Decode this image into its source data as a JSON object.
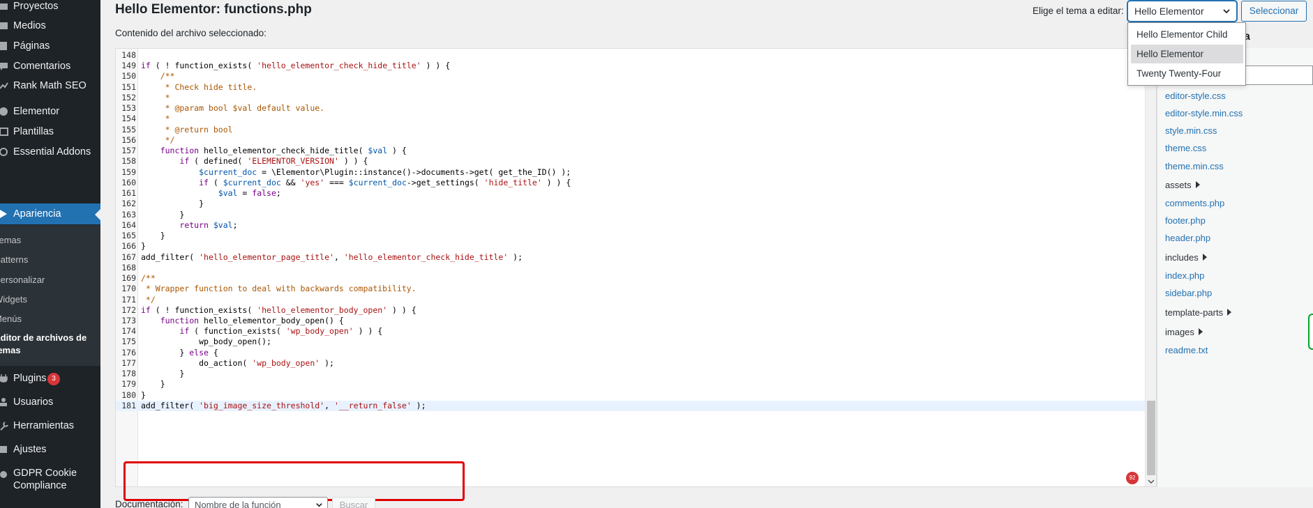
{
  "sidebar": {
    "items": [
      {
        "label": "Proyectos",
        "icon": "folder-icon"
      },
      {
        "label": "Medios",
        "icon": "media-icon"
      },
      {
        "label": "Páginas",
        "icon": "page-icon"
      },
      {
        "label": "Comentarios",
        "icon": "comment-icon"
      },
      {
        "label": "Rank Math SEO",
        "icon": "rank-math-icon"
      },
      {
        "label": "Elementor",
        "icon": "elementor-icon"
      },
      {
        "label": "Plantillas",
        "icon": "templates-icon"
      },
      {
        "label": "Essential Addons",
        "icon": "essential-addons-icon"
      },
      {
        "label": "Apariencia",
        "icon": "appearance-icon"
      },
      {
        "label": "Plugins",
        "icon": "plugins-icon"
      },
      {
        "label": "Usuarios",
        "icon": "users-icon"
      },
      {
        "label": "Herramientas",
        "icon": "tools-icon"
      },
      {
        "label": "Ajustes",
        "icon": "settings-icon"
      },
      {
        "label": "GDPR Cookie",
        "label2": "Compliance",
        "icon": "gdpr-icon"
      }
    ],
    "plugins_badge": "3",
    "submenu": [
      {
        "label": "Temas"
      },
      {
        "label": "Patterns"
      },
      {
        "label": "Personalizar"
      },
      {
        "label": "Widgets"
      },
      {
        "label": "Menús"
      },
      {
        "label": "Editor de archivos de",
        "label2": "temas"
      }
    ]
  },
  "header": {
    "title": "Hello Elementor: functions.php",
    "file_label": "Contenido del archivo seleccionado:",
    "theme_label": "Elige el tema a editar:",
    "theme_selected": "Hello Elementor",
    "select_button": "Seleccionar",
    "theme_options": [
      "Hello Elementor Child",
      "Hello Elementor",
      "Twenty Twenty-Four"
    ]
  },
  "editor": {
    "lines": [
      {
        "n": "148",
        "t": ""
      },
      {
        "n": "149",
        "t": "if ( ! function_exists( 'hello_elementor_check_hide_title' ) ) {"
      },
      {
        "n": "150",
        "t": "    /**"
      },
      {
        "n": "151",
        "t": "     * Check hide title."
      },
      {
        "n": "152",
        "t": "     *"
      },
      {
        "n": "153",
        "t": "     * @param bool $val default value."
      },
      {
        "n": "154",
        "t": "     *"
      },
      {
        "n": "155",
        "t": "     * @return bool"
      },
      {
        "n": "156",
        "t": "     */"
      },
      {
        "n": "157",
        "t": "    function hello_elementor_check_hide_title( $val ) {"
      },
      {
        "n": "158",
        "t": "        if ( defined( 'ELEMENTOR_VERSION' ) ) {"
      },
      {
        "n": "159",
        "t": "            $current_doc = \\Elementor\\Plugin::instance()->documents->get( get_the_ID() );"
      },
      {
        "n": "160",
        "t": "            if ( $current_doc && 'yes' === $current_doc->get_settings( 'hide_title' ) ) {"
      },
      {
        "n": "161",
        "t": "                $val = false;"
      },
      {
        "n": "162",
        "t": "            }"
      },
      {
        "n": "163",
        "t": "        }"
      },
      {
        "n": "164",
        "t": "        return $val;"
      },
      {
        "n": "165",
        "t": "    }"
      },
      {
        "n": "166",
        "t": "}"
      },
      {
        "n": "167",
        "t": "add_filter( 'hello_elementor_page_title', 'hello_elementor_check_hide_title' );"
      },
      {
        "n": "168",
        "t": ""
      },
      {
        "n": "169",
        "t": "/**"
      },
      {
        "n": "170",
        "t": " * Wrapper function to deal with backwards compatibility."
      },
      {
        "n": "171",
        "t": " */"
      },
      {
        "n": "172",
        "t": "if ( ! function_exists( 'hello_elementor_body_open' ) ) {"
      },
      {
        "n": "173",
        "t": "    function hello_elementor_body_open() {"
      },
      {
        "n": "174",
        "t": "        if ( function_exists( 'wp_body_open' ) ) {"
      },
      {
        "n": "175",
        "t": "            wp_body_open();"
      },
      {
        "n": "176",
        "t": "        } else {"
      },
      {
        "n": "177",
        "t": "            do_action( 'wp_body_open' );"
      },
      {
        "n": "178",
        "t": "        }"
      },
      {
        "n": "179",
        "t": "    }"
      },
      {
        "n": "180",
        "t": "}"
      },
      {
        "n": "181",
        "t": "add_filter( 'big_image_size_threshold', '__return_false' );"
      }
    ],
    "error_count": "92"
  },
  "files": {
    "heading_partial": "a",
    "items": [
      {
        "label": "editor-style.css",
        "type": "file"
      },
      {
        "label": "editor-style.min.css",
        "type": "file"
      },
      {
        "label": "style.min.css",
        "type": "file"
      },
      {
        "label": "theme.css",
        "type": "file"
      },
      {
        "label": "theme.min.css",
        "type": "file"
      },
      {
        "label": "assets",
        "type": "folder"
      },
      {
        "label": "comments.php",
        "type": "file"
      },
      {
        "label": "footer.php",
        "type": "file"
      },
      {
        "label": "header.php",
        "type": "file"
      },
      {
        "label": "includes",
        "type": "folder"
      },
      {
        "label": "index.php",
        "type": "file"
      },
      {
        "label": "sidebar.php",
        "type": "file"
      },
      {
        "label": "template-parts",
        "type": "folder"
      },
      {
        "label": "images",
        "type": "folder"
      },
      {
        "label": "readme.txt",
        "type": "file"
      }
    ]
  },
  "docs": {
    "label": "Documentación:",
    "placeholder": "Nombre de la función",
    "button": "Buscar"
  },
  "colors": {
    "sidebar_bg": "#1d2327",
    "accent": "#2271b1",
    "badge": "#d63638",
    "highlight_box": "#e00000"
  }
}
